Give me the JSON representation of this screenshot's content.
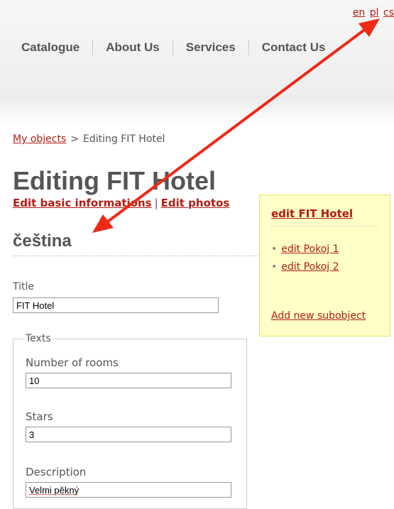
{
  "languages": [
    "en",
    "pl",
    "cs"
  ],
  "nav": {
    "items": [
      "Catalogue",
      "About Us",
      "Services",
      "Contact Us"
    ]
  },
  "breadcrumb": {
    "link": "My objects",
    "separator": ">",
    "current": "Editing FIT Hotel"
  },
  "page": {
    "title": "Editing FIT Hotel",
    "edit_basic_link": "Edit basic informations",
    "link_separator": "|",
    "edit_photos_link": "Edit photos",
    "language_heading": "čeština"
  },
  "form": {
    "title_label": "Title",
    "title_value": "FIT Hotel",
    "texts_legend": "Texts",
    "rooms_label": "Number of rooms",
    "rooms_value": "10",
    "stars_label": "Stars",
    "stars_value": "3",
    "description_label": "Description",
    "description_value": "Velmi pěkný"
  },
  "sidebox": {
    "title": "edit FIT Hotel",
    "items": [
      "edit Pokoj 1",
      "edit Pokoj 2"
    ],
    "add_link": "Add new subobject"
  },
  "colors": {
    "link": "#b31c12",
    "sidebox_bg": "#ffffc8",
    "annotation_arrow": "#ee2a17"
  },
  "annotation": {
    "icon": "double-headed-arrow"
  }
}
